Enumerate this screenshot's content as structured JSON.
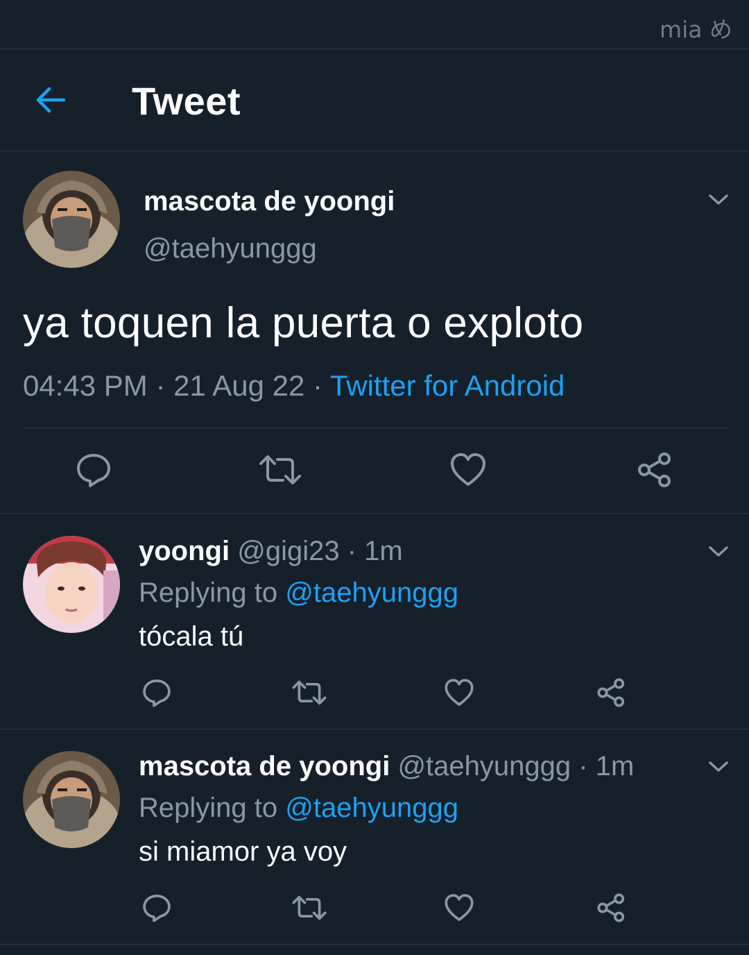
{
  "watermark": "mia め",
  "header": {
    "title": "Tweet",
    "back_icon": "arrow-left-icon"
  },
  "colors": {
    "background": "#15202b",
    "accent": "#1da1f2",
    "secondary_text": "#8899a6",
    "divider": "#2f3b47"
  },
  "main_tweet": {
    "display_name": "mascota de yoongi",
    "handle": "@taehyunggg",
    "text": "ya toquen la puerta o exploto",
    "time": "04:43 PM",
    "date": "21 Aug 22",
    "separator": "·",
    "source": "Twitter for Android",
    "actions": [
      "reply-icon",
      "retweet-icon",
      "like-icon",
      "share-icon"
    ]
  },
  "replies": [
    {
      "display_name": "yoongi",
      "handle": "@gigi23",
      "separator": "·",
      "age": "1m",
      "replying_prefix": "Replying to",
      "replying_to": "@taehyunggg",
      "text": "tócala tú"
    },
    {
      "display_name": "mascota de yoongi",
      "handle": "@taehyunggg",
      "separator": "·",
      "age": "1m",
      "replying_prefix": "Replying to",
      "replying_to": "@taehyunggg",
      "text": "si miamor ya voy"
    }
  ]
}
